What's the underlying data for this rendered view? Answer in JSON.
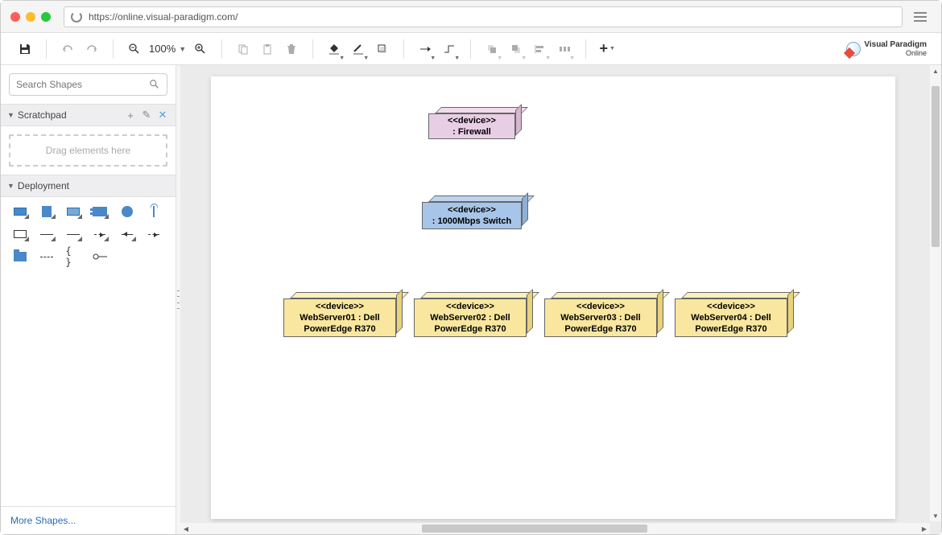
{
  "browser": {
    "url": "https://online.visual-paradigm.com/"
  },
  "toolbar": {
    "zoom_level": "100%"
  },
  "logo": {
    "line1": "Visual Paradigm",
    "line2": "Online"
  },
  "sidebar": {
    "search_placeholder": "Search Shapes",
    "scratchpad": {
      "title": "Scratchpad",
      "drop_hint": "Drag elements here"
    },
    "deployment": {
      "title": "Deployment"
    },
    "more_shapes": "More Shapes..."
  },
  "diagram": {
    "firewall": {
      "stereo": "<<device>>",
      "label": ": Firewall"
    },
    "switch": {
      "stereo": "<<device>>",
      "label": ": 1000Mbps Switch"
    },
    "ws1": {
      "stereo": "<<device>>",
      "l1": "WebServer01 : Dell",
      "l2": "PowerEdge R370"
    },
    "ws2": {
      "stereo": "<<device>>",
      "l1": "WebServer02 : Dell",
      "l2": "PowerEdge R370"
    },
    "ws3": {
      "stereo": "<<device>>",
      "l1": "WebServer03 : Dell",
      "l2": "PowerEdge R370"
    },
    "ws4": {
      "stereo": "<<device>>",
      "l1": "WebServer04 : Dell",
      "l2": "PowerEdge R370"
    }
  },
  "chart_data": {
    "type": "diagram",
    "diagram_type": "UML Deployment Diagram",
    "nodes": [
      {
        "id": "firewall",
        "stereotype": "device",
        "name": ": Firewall",
        "color": "pink"
      },
      {
        "id": "switch",
        "stereotype": "device",
        "name": ": 1000Mbps Switch",
        "color": "blue"
      },
      {
        "id": "ws1",
        "stereotype": "device",
        "name": "WebServer01 : Dell PowerEdge R370",
        "color": "yellow"
      },
      {
        "id": "ws2",
        "stereotype": "device",
        "name": "WebServer02 : Dell PowerEdge R370",
        "color": "yellow"
      },
      {
        "id": "ws3",
        "stereotype": "device",
        "name": "WebServer03 : Dell PowerEdge R370",
        "color": "yellow"
      },
      {
        "id": "ws4",
        "stereotype": "device",
        "name": "WebServer04 : Dell PowerEdge R370",
        "color": "yellow"
      }
    ],
    "edges": [
      {
        "from": "firewall",
        "to": "switch"
      },
      {
        "from": "switch",
        "to": "ws1"
      },
      {
        "from": "switch",
        "to": "ws2"
      },
      {
        "from": "switch",
        "to": "ws3"
      },
      {
        "from": "switch",
        "to": "ws4"
      }
    ]
  }
}
